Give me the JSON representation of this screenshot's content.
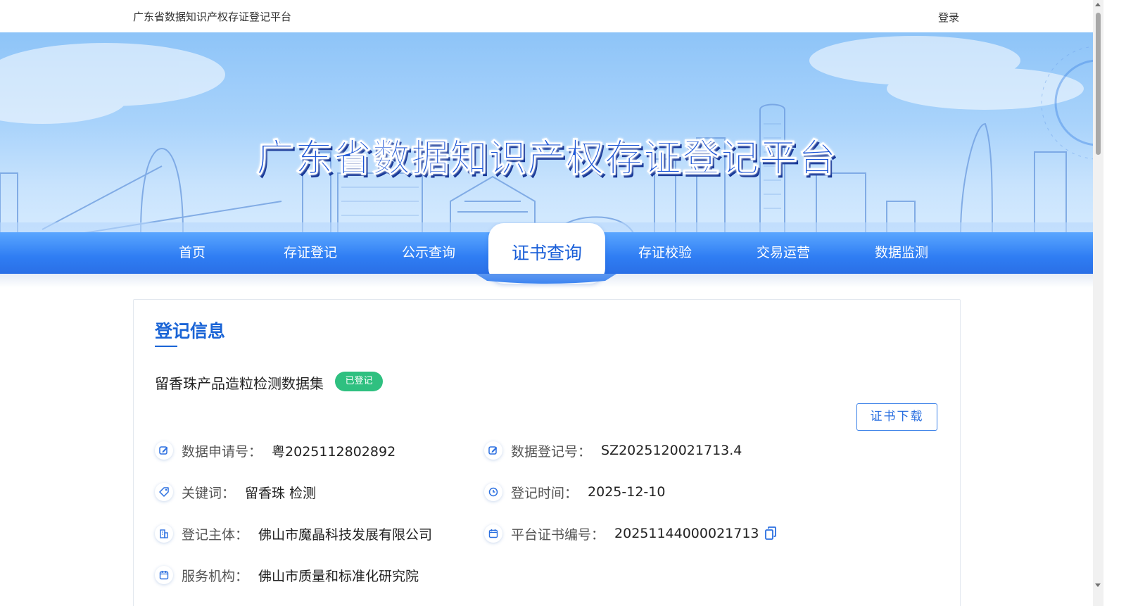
{
  "header": {
    "site_name": "广东省数据知识产权存证登记平台",
    "login_label": "登录"
  },
  "banner": {
    "title": "广东省数据知识产权存证登记平台"
  },
  "nav": {
    "items": [
      {
        "label": "首页",
        "active": false
      },
      {
        "label": "存证登记",
        "active": false
      },
      {
        "label": "公示查询",
        "active": false
      },
      {
        "label": "证书查询",
        "active": true
      },
      {
        "label": "存证校验",
        "active": false
      },
      {
        "label": "交易运营",
        "active": false
      },
      {
        "label": "数据监测",
        "active": false
      }
    ]
  },
  "registration": {
    "section_title": "登记信息",
    "dataset_name": "留香珠产品造粒检测数据集",
    "status": "已登记",
    "download_label": "证书下载",
    "fields": {
      "application_no": {
        "label": "数据申请号：",
        "value": "粤2025112802892",
        "icon": "edit-icon"
      },
      "registration_no": {
        "label": "数据登记号：",
        "value": "SZ2025120021713.4",
        "icon": "edit-icon"
      },
      "keywords": {
        "label": "关键词：",
        "value": "留香珠 检测",
        "icon": "tag-icon"
      },
      "registration_time": {
        "label": "登记时间：",
        "value": "2025-12-10",
        "icon": "clock-icon"
      },
      "registrant": {
        "label": "登记主体：",
        "value": "佛山市魔晶科技发展有限公司",
        "icon": "building-icon"
      },
      "certificate_no": {
        "label": "平台证书编号：",
        "value": "20251144000021713",
        "icon": "calendar-icon"
      },
      "service_agency": {
        "label": "服务机构：",
        "value": "佛山市质量和标准化研究院",
        "icon": "calendar-icon"
      }
    }
  },
  "colors": {
    "primary": "#1a64d6",
    "nav_gradient_top": "#5aa6ff",
    "nav_gradient_bottom": "#2a6fe6",
    "status_green": "#2fc080"
  }
}
